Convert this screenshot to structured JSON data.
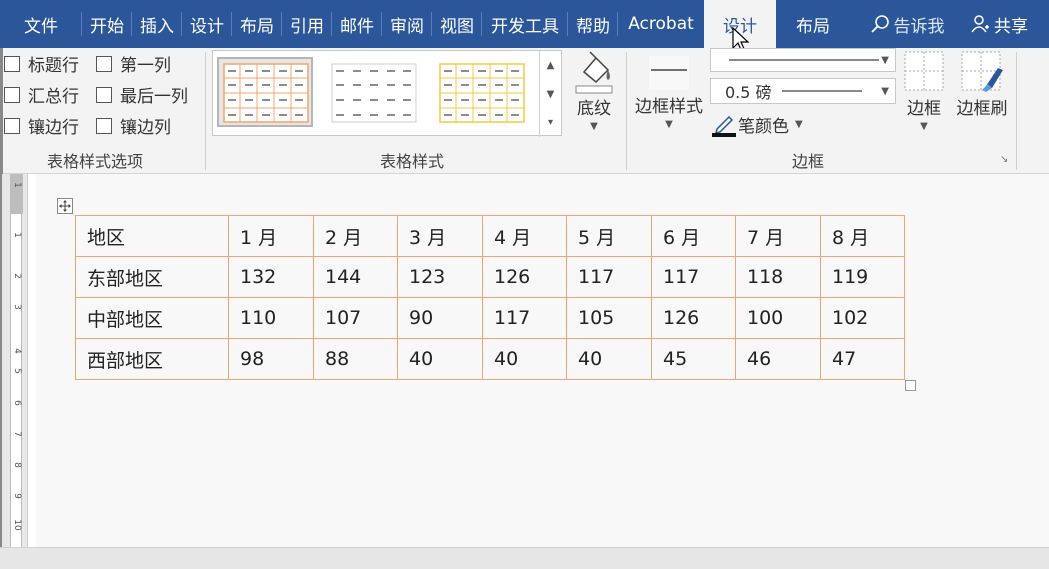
{
  "tabs": [
    {
      "label": "文件",
      "name": "tab-file"
    },
    {
      "label": "开始",
      "name": "tab-home"
    },
    {
      "label": "插入",
      "name": "tab-insert"
    },
    {
      "label": "设计",
      "name": "tab-design"
    },
    {
      "label": "布局",
      "name": "tab-layout"
    },
    {
      "label": "引用",
      "name": "tab-references"
    },
    {
      "label": "邮件",
      "name": "tab-mailings"
    },
    {
      "label": "审阅",
      "name": "tab-review"
    },
    {
      "label": "视图",
      "name": "tab-view"
    },
    {
      "label": "开发工具",
      "name": "tab-developer"
    },
    {
      "label": "帮助",
      "name": "tab-help"
    },
    {
      "label": "Acrobat",
      "name": "tab-acrobat"
    }
  ],
  "context_tabs": {
    "design": "设计",
    "layout": "布局"
  },
  "search": {
    "label": "告诉我"
  },
  "share": {
    "label": "共享"
  },
  "style_options": {
    "header_row": "标题行",
    "first_column": "第一列",
    "total_row": "汇总行",
    "last_column": "最后一列",
    "banded_rows": "镶边行",
    "banded_columns": "镶边列",
    "group_label": "表格样式选项"
  },
  "table_styles": {
    "group_label": "表格样式",
    "shading_label": "底纹"
  },
  "borders": {
    "border_styles_label": "边框样式",
    "weight": "0.5 磅",
    "pen_color_label": "笔颜色",
    "borders_label": "边框",
    "border_painter_label": "边框刷",
    "group_label": "边框"
  },
  "ruler": {
    "numbers": [
      "1",
      "1",
      "2",
      "3",
      "4",
      "5",
      "6",
      "7",
      "8",
      "9",
      "10"
    ]
  },
  "colors": {
    "accent": "#2b579a",
    "table_border": "#f2a574",
    "gallery_orange": "#f4a46b",
    "gallery_gold": "#f5c842"
  },
  "table": {
    "header": [
      "地区",
      "1 月",
      "2 月",
      "3 月",
      "4 月",
      "5 月",
      "6 月",
      "7 月",
      "8 月"
    ],
    "rows": [
      [
        "东部地区",
        "132",
        "144",
        "123",
        "126",
        "117",
        "117",
        "118",
        "119"
      ],
      [
        "中部地区",
        "110",
        "107",
        "90",
        "117",
        "105",
        "126",
        "100",
        "102"
      ],
      [
        "西部地区",
        "98",
        "88",
        "40",
        "40",
        "40",
        "45",
        "46",
        "47"
      ]
    ]
  }
}
